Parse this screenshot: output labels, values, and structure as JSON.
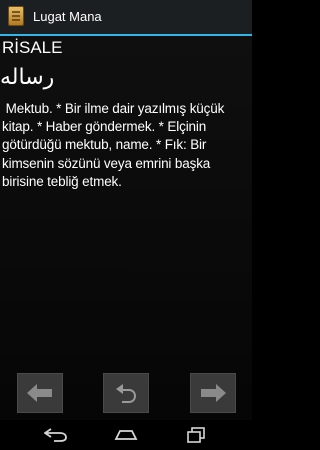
{
  "app": {
    "title": "Lugat Mana",
    "icon": "book-icon",
    "accent_color": "#33b5e5"
  },
  "entry": {
    "word": "RİSALE",
    "arabic": "رساله",
    "definition": " Mektub. * Bir ilme dair yazılmış küçük kitap. * Haber göndermek. * Elçinin götürdüğü mektub, name. * Fık: Bir kimsenin sözünü veya emrini başka birisine tebliğ etmek."
  },
  "nav_buttons": {
    "previous_icon": "arrow-left-icon",
    "undo_icon": "undo-icon",
    "next_icon": "arrow-right-icon"
  },
  "system_nav": {
    "back_icon": "back-icon",
    "home_icon": "home-icon",
    "recents_icon": "recents-icon"
  }
}
